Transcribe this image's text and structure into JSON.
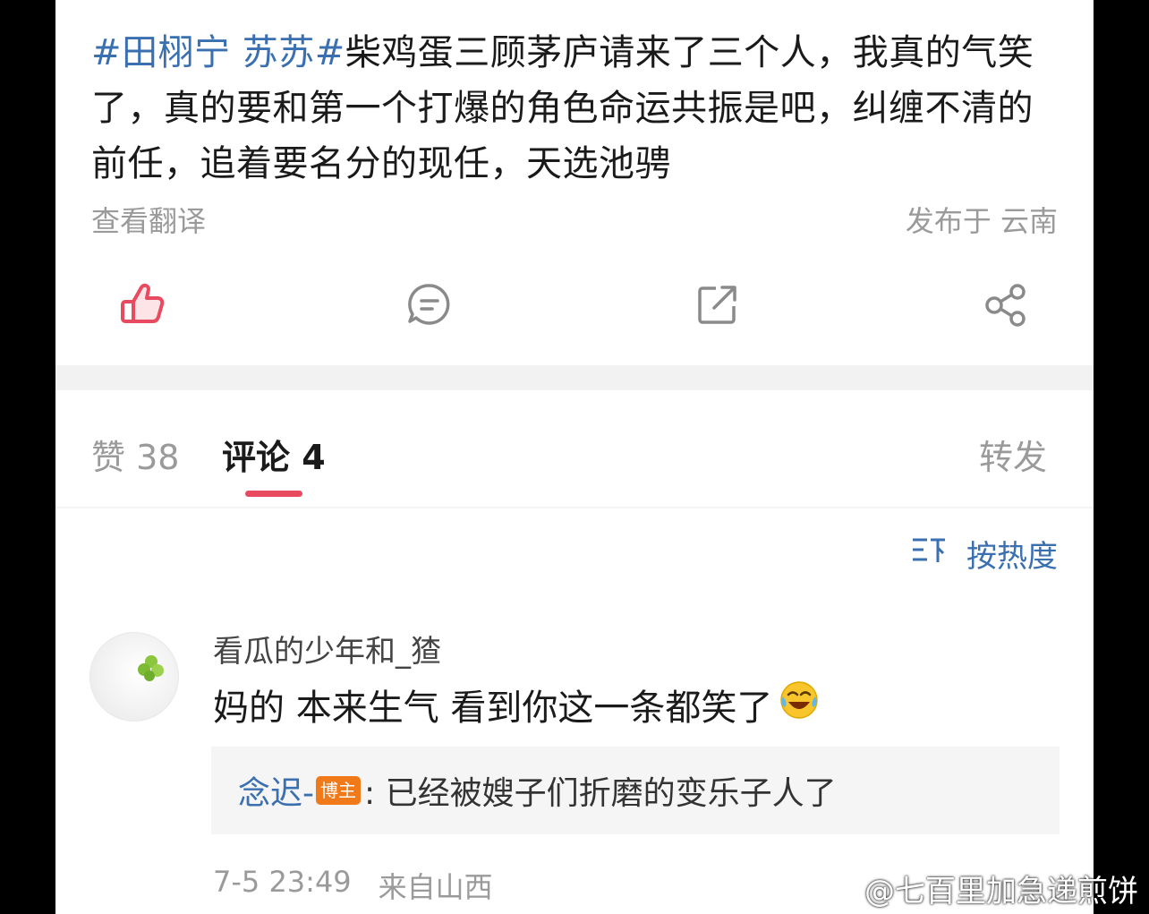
{
  "post": {
    "hashtag": "#田栩宁 苏苏#",
    "body": "柴鸡蛋三顾茅庐请来了三个人，我真的气笑了，真的要和第一个打爆的角色命运共振是吧，纠缠不清的前任，追着要名分的现任，天选池骋",
    "translate_label": "查看翻译",
    "location": "发布于 云南"
  },
  "actions": {
    "icons": [
      "thumbs-up-icon",
      "comment-icon",
      "repost-icon",
      "share-icon"
    ],
    "like_color": "#e84a5f"
  },
  "tabs": {
    "likes": "赞 38",
    "comments": "评论 4",
    "reposts": "转发"
  },
  "sort": {
    "label": "按热度",
    "icon": "sort-icon"
  },
  "comment": {
    "username": "看瓜的少年和_猹",
    "text": "妈的 本来生气 看到你这一条都笑了",
    "emoji": "laughing-crying-emoji",
    "reply": {
      "author": "念迟-",
      "badge": "博主",
      "text": ": 已经被嫂子们折磨的变乐子人了"
    },
    "time": "7-5 23:49",
    "source": "来自山西"
  },
  "watermark": {
    "text": "@七百里加急递煎饼"
  },
  "colors": {
    "accent_blue": "#3a6fb0",
    "accent_red": "#e84a5f",
    "badge_orange": "#f07a1a"
  }
}
